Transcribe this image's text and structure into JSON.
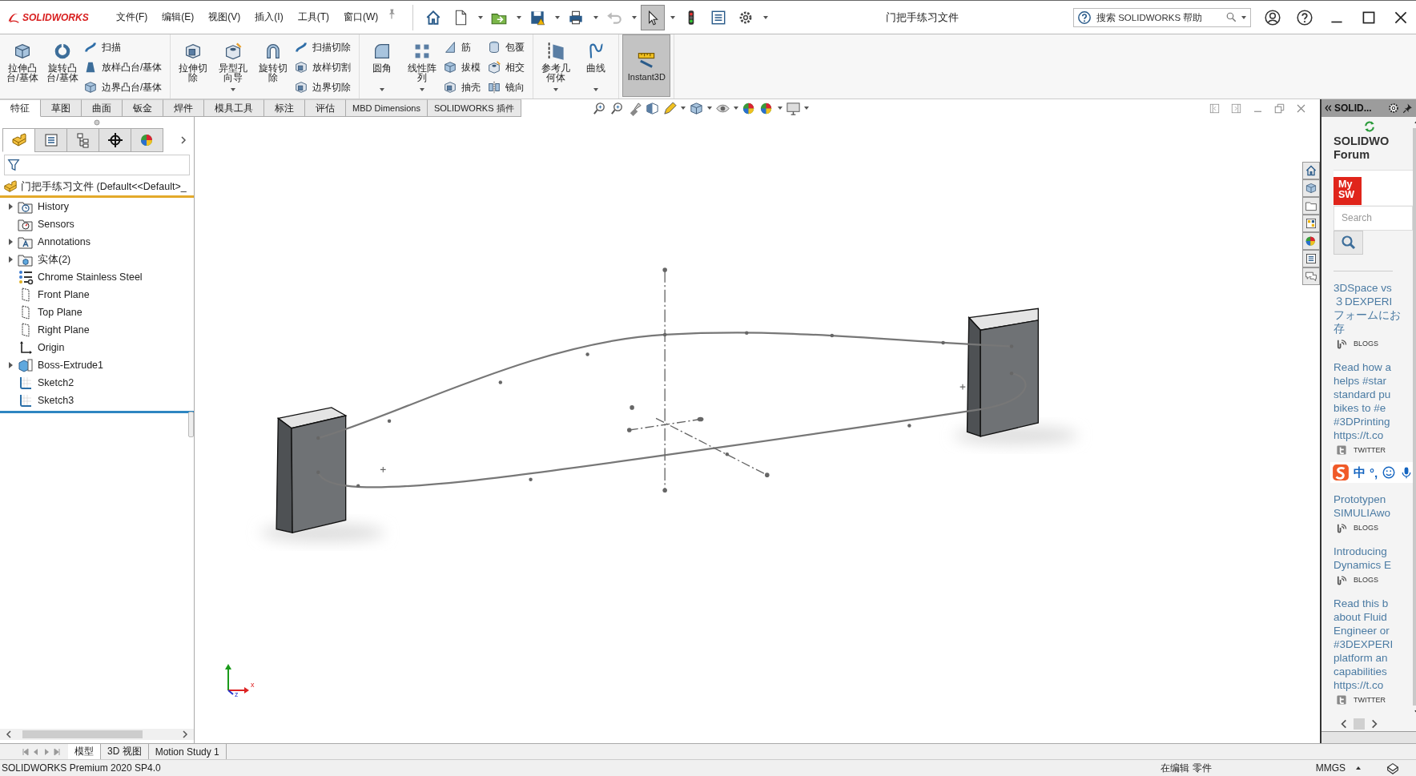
{
  "logo": "SOLIDWORKS",
  "menus": [
    "文件(F)",
    "编辑(E)",
    "视图(V)",
    "插入(I)",
    "工具(T)",
    "窗口(W)"
  ],
  "quick_access": [
    {
      "pressed": false,
      "disabled": false,
      "dropdown": false
    },
    {
      "pressed": false,
      "disabled": false,
      "dropdown": true
    },
    {
      "pressed": false,
      "disabled": false,
      "dropdown": true
    },
    {
      "pressed": false,
      "disabled": false,
      "dropdown": true
    },
    {
      "pressed": false,
      "disabled": false,
      "dropdown": true
    },
    {
      "pressed": false,
      "disabled": true,
      "dropdown": true
    },
    {
      "pressed": true,
      "disabled": false,
      "dropdown": true
    },
    {
      "pressed": false,
      "disabled": false,
      "dropdown": false
    },
    {
      "pressed": false,
      "disabled": false,
      "dropdown": false
    },
    {
      "pressed": false,
      "disabled": false,
      "dropdown": true
    }
  ],
  "title": "门把手练习文件",
  "help_search": {
    "placeholder": "搜索 SOLIDWORKS 帮助"
  },
  "ribbon": {
    "groups": [
      {
        "large": [
          {
            "lines": [
              "拉伸凸",
              "台/基体"
            ],
            "dropdown": false,
            "pressed": false
          },
          {
            "lines": [
              "旋转凸",
              "台/基体"
            ],
            "dropdown": false,
            "pressed": false
          }
        ],
        "small_columns": [
          [
            "扫描",
            "放样凸台/基体",
            "边界凸台/基体"
          ]
        ]
      },
      {
        "large": [
          {
            "lines": [
              "拉伸切",
              "除"
            ],
            "dropdown": false,
            "pressed": false
          },
          {
            "lines": [
              "异型孔",
              "向导"
            ],
            "dropdown": true,
            "pressed": false
          },
          {
            "lines": [
              "旋转切",
              "除"
            ],
            "dropdown": false,
            "pressed": false
          }
        ],
        "small_columns": [
          [
            "扫描切除",
            "放样切割",
            "边界切除"
          ]
        ]
      },
      {
        "large": [
          {
            "lines": [
              "圆角"
            ],
            "dropdown": true,
            "pressed": false
          },
          {
            "lines": [
              "线性阵",
              "列"
            ],
            "dropdown": true,
            "pressed": false
          }
        ],
        "small_columns": [
          [
            "筋",
            "拔模",
            "抽壳"
          ],
          [
            "包覆",
            "相交",
            "镜向"
          ]
        ]
      },
      {
        "large": [
          {
            "lines": [
              "参考几",
              "何体"
            ],
            "dropdown": true,
            "pressed": false
          },
          {
            "lines": [
              "曲线"
            ],
            "dropdown": true,
            "pressed": false
          }
        ]
      },
      {
        "large": [
          {
            "lines": [
              "Instant3D"
            ],
            "dropdown": false,
            "pressed": true
          }
        ]
      }
    ]
  },
  "command_tabs": [
    {
      "label": "特征",
      "selected": true
    },
    {
      "label": "草图",
      "selected": false
    },
    {
      "label": "曲面",
      "selected": false
    },
    {
      "label": "钣金",
      "selected": false
    },
    {
      "label": "焊件",
      "selected": false
    },
    {
      "label": "模具工具",
      "selected": false
    },
    {
      "label": "标注",
      "selected": false
    },
    {
      "label": "评估",
      "selected": false
    },
    {
      "label": "MBD Dimensions",
      "selected": false
    },
    {
      "label": "SOLIDWORKS 插件",
      "selected": false
    }
  ],
  "feature_manager": {
    "tabs": [
      {
        "selected": true
      },
      {
        "selected": false
      },
      {
        "selected": false
      },
      {
        "selected": false
      },
      {
        "selected": false
      }
    ],
    "root": {
      "label": "门把手练习文件  (Default<<Default>_",
      "children": [
        {
          "label": "History",
          "kind": "history",
          "expandable": true
        },
        {
          "label": "Sensors",
          "kind": "sensors",
          "expandable": false
        },
        {
          "label": "Annotations",
          "kind": "annotations",
          "expandable": true
        },
        {
          "label": "实体(2)",
          "kind": "bodies",
          "expandable": true
        },
        {
          "label": "Chrome Stainless Steel",
          "kind": "material",
          "expandable": false
        },
        {
          "label": "Front Plane",
          "kind": "plane",
          "expandable": false
        },
        {
          "label": "Top Plane",
          "kind": "plane",
          "expandable": false
        },
        {
          "label": "Right Plane",
          "kind": "plane",
          "expandable": false
        },
        {
          "label": "Origin",
          "kind": "origin",
          "expandable": false
        },
        {
          "label": "Boss-Extrude1",
          "kind": "feature",
          "expandable": true
        },
        {
          "label": "Sketch2",
          "kind": "sketch",
          "expandable": false
        },
        {
          "label": "Sketch3",
          "kind": "sketch",
          "expandable": false
        }
      ]
    }
  },
  "triad": {
    "x": "x",
    "z": "z"
  },
  "task_pane": {
    "title": "SOLID...",
    "heading_lines": [
      "SOLIDWO",
      "Forum"
    ],
    "logo_lines": [
      "My",
      "SW"
    ],
    "search": {
      "placeholder": "Search"
    },
    "posts": [
      {
        "kind": "blog",
        "lines": [
          "3DSpace vs",
          "３DEXPERI",
          "フォームにお",
          "存"
        ],
        "source": "BLOGS"
      },
      {
        "kind": "tweet",
        "lines": [
          "Read how a",
          "helps #star",
          "standard pu",
          "bikes to #e",
          "#3DPrinting",
          "https://t.co"
        ],
        "source": "TWITTER"
      },
      {
        "kind": "blog",
        "lines": [
          "Prototypen",
          "SIMULIAwo"
        ],
        "source": "BLOGS",
        "ime_bar": {
          "language": "中",
          "punctuation": "°,"
        }
      },
      {
        "kind": "blog",
        "lines": [
          "Introducing",
          "Dynamics E"
        ],
        "source": "BLOGS"
      },
      {
        "kind": "tweet",
        "lines": [
          "Read this b",
          "about Fluid",
          "Engineer or",
          "#3DEXPERI",
          "platform an",
          "capabilities",
          "https://t.co"
        ],
        "source": "TWITTER"
      }
    ]
  },
  "bottom_tabs": [
    {
      "label": "模型",
      "selected": true
    },
    {
      "label": "3D 视图",
      "selected": false
    },
    {
      "label": "Motion Study 1",
      "selected": false
    }
  ],
  "status_bar": {
    "product": "SOLIDWORKS Premium 2020 SP4.0",
    "mode": "在编辑 零件",
    "units": "MMGS"
  }
}
